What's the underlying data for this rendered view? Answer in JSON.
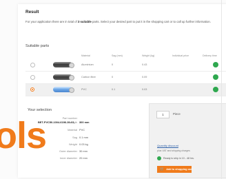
{
  "result": {
    "title": "Result",
    "description_pre": "For your application there are in total of ",
    "description_bold": "3 suitable",
    "description_post": " parts. Select your desired part to put it in the shopping cart or to call up further information."
  },
  "suitable_parts": {
    "title": "Suitable parts",
    "columns": [
      "Material",
      "Sag (mm)",
      "Weight (kg)",
      "Individual price",
      "Delivery time"
    ],
    "rows": [
      {
        "material": "Aluminium",
        "sag": "0",
        "weight": "0.43",
        "selected": false,
        "image": "dark-tube"
      },
      {
        "material": "Carbon fibre",
        "sag": "0",
        "weight": "0.09",
        "selected": false,
        "image": "dark-tube"
      },
      {
        "material": "PVC",
        "sag": "0.1",
        "weight": "0.03",
        "selected": true,
        "image": "blue-tube"
      }
    ],
    "in_stock_color": "#2fa84f"
  },
  "selection": {
    "title": "Your selection",
    "details": [
      {
        "key": "Part number",
        "value": "BET-PVC50-1004-6196-30-03",
        "strong": true
      },
      {
        "key": "Length",
        "value": "300 mm",
        "strong": true
      },
      {
        "key": "Material",
        "value": "PVC",
        "strong": false
      },
      {
        "key": "Sag",
        "value": "0.1 mm",
        "strong": false
      },
      {
        "key": "Weight",
        "value": "0.03 kg",
        "strong": false
      },
      {
        "key": "Outer diameter",
        "value": "30 mm",
        "strong": false
      },
      {
        "key": "Inner diameter",
        "value": "20 mm",
        "strong": false
      }
    ]
  },
  "order": {
    "quantity": "1",
    "unit": "Piece",
    "quantity_discount_link": "Quantity discount",
    "shipping_note": "plus VAT and shipping charges",
    "ready_text": "Ready to ship in 10 - 48 hrs.",
    "cart_button": "Add to shopping cart",
    "cart_icon": "cart-icon",
    "accent_color": "#f07b1b"
  },
  "overlay": {
    "logo_text": "ols"
  }
}
